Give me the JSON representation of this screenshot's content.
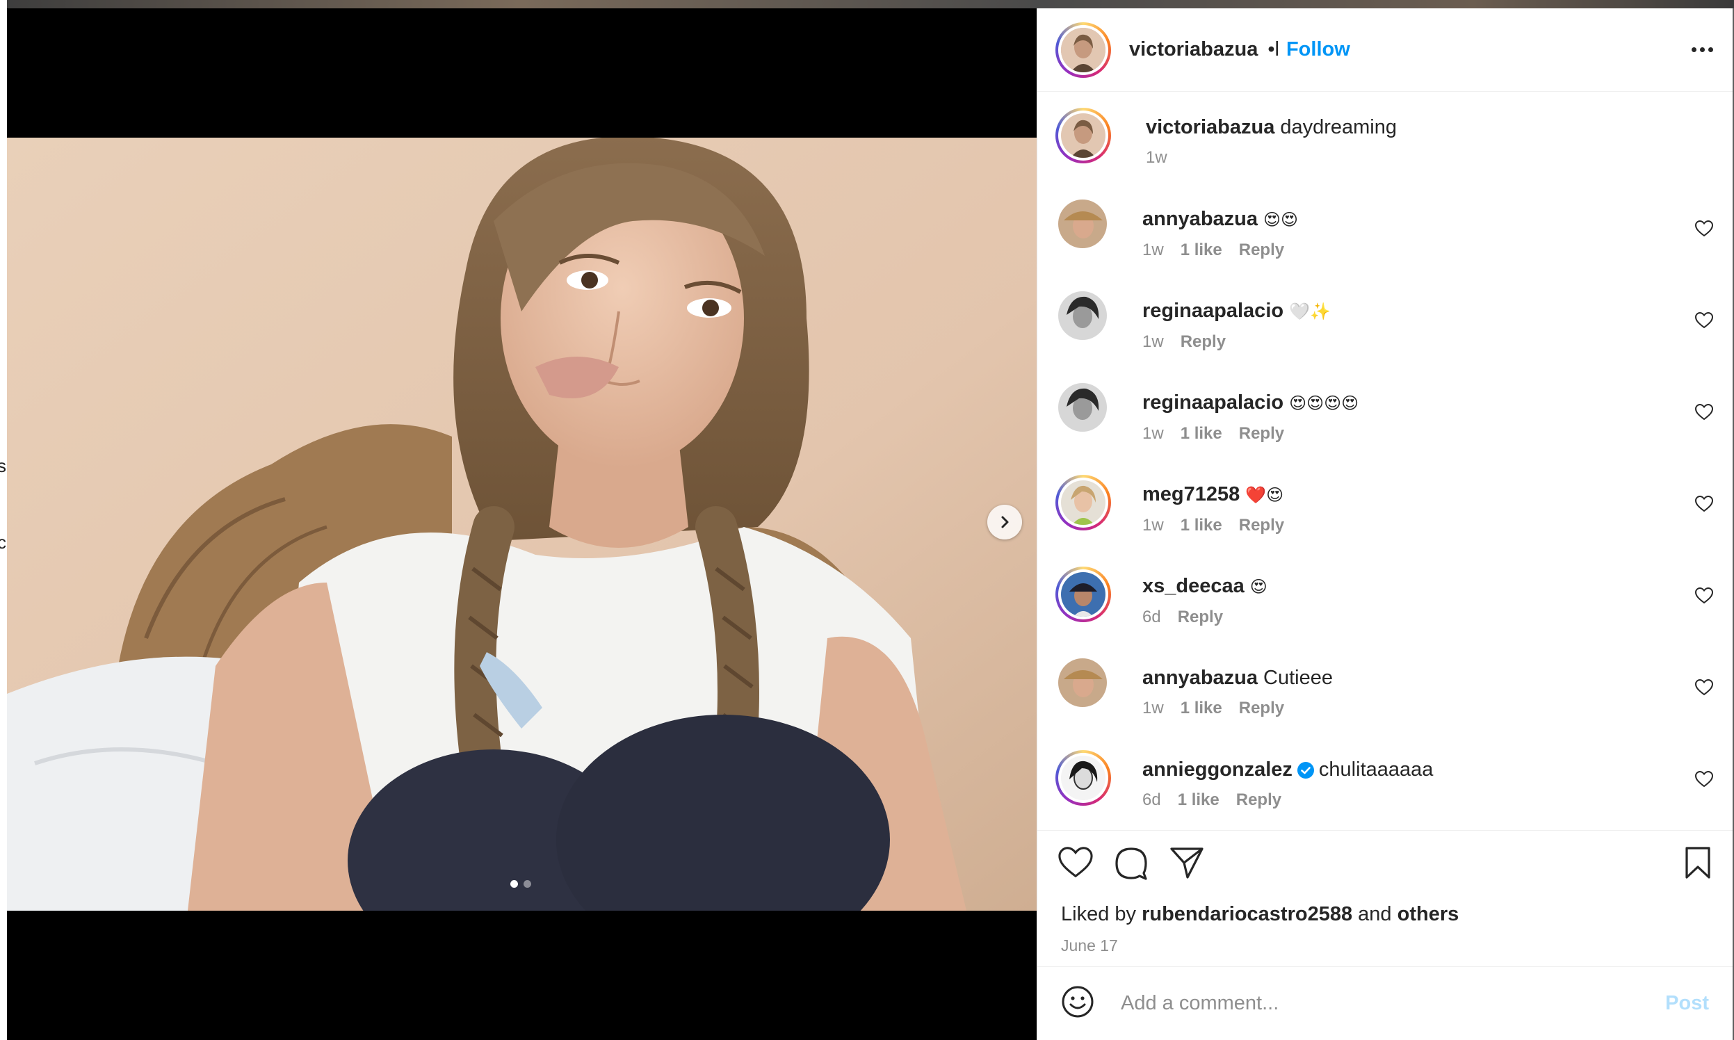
{
  "post": {
    "author": "victoriabazua",
    "follow_separator": "•l",
    "follow_label": "Follow",
    "caption_text": "daydreaming",
    "caption_time": "1w",
    "slide_index": 0,
    "slide_count": 2
  },
  "comments": [
    {
      "user": "annyabazua",
      "text": "😍😍",
      "time": "1w",
      "likes": "1 like",
      "reply": "Reply",
      "verified": false
    },
    {
      "user": "reginaapalacio",
      "text": "🤍✨",
      "time": "1w",
      "likes": "",
      "reply": "Reply",
      "verified": false
    },
    {
      "user": "reginaapalacio",
      "text": "😍😍😍😍",
      "time": "1w",
      "likes": "1 like",
      "reply": "Reply",
      "verified": false
    },
    {
      "user": "meg71258",
      "text": "❤️😍",
      "time": "1w",
      "likes": "1 like",
      "reply": "Reply",
      "verified": false
    },
    {
      "user": "xs_deecaa",
      "text": "😍",
      "time": "6d",
      "likes": "",
      "reply": "Reply",
      "verified": false
    },
    {
      "user": "annyabazua",
      "text": "Cutieee",
      "time": "1w",
      "likes": "1 like",
      "reply": "Reply",
      "verified": false
    },
    {
      "user": "annieggonzalez",
      "text": "chulitaaaaaa",
      "time": "6d",
      "likes": "1 like",
      "reply": "Reply",
      "verified": true
    }
  ],
  "likes": {
    "prefix": "Liked by",
    "user": "rubendariocastro2588",
    "middle": "and",
    "suffix": "others"
  },
  "date": "June 17",
  "composer": {
    "placeholder": "Add a comment...",
    "post_label": "Post"
  },
  "icons": {
    "like": "heart-icon",
    "comment": "comment-icon",
    "share": "send-icon",
    "save": "bookmark-icon",
    "emoji": "emoji-icon",
    "next": "chevron-right-icon",
    "more": "more-icon"
  },
  "colors": {
    "accent": "#0095f6",
    "post_disabled": "#b2dffc",
    "muted": "#8e8e8e",
    "text": "#262626"
  }
}
